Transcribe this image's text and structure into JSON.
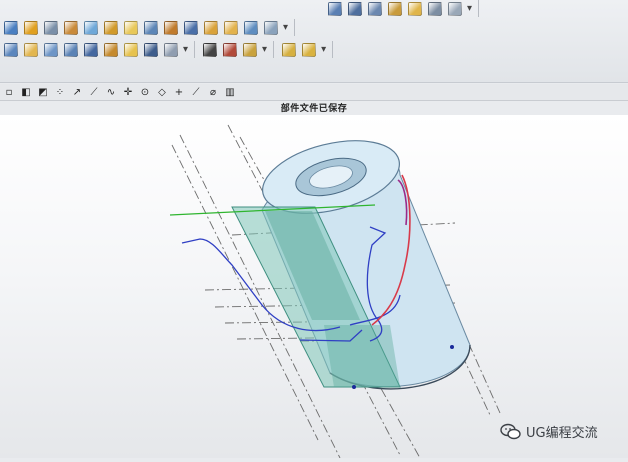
{
  "status": {
    "message": "部件文件已保存"
  },
  "watermark": {
    "text": "UG编程交流",
    "icon": "wechat-icon"
  },
  "toolbar_row1": [
    {
      "icon": "extrude-icon",
      "color": "#4a7fc1"
    },
    {
      "icon": "revolve-icon",
      "color": "#e0a020"
    },
    {
      "icon": "sweep-icon",
      "color": "#7a8fa8"
    },
    {
      "icon": "hole-icon",
      "color": "#c98a3a"
    },
    {
      "icon": "boss-icon",
      "color": "#6fa8d8"
    },
    {
      "icon": "pocket-icon",
      "color": "#d19a2b"
    },
    {
      "icon": "pad-icon",
      "color": "#e8c85a"
    },
    {
      "icon": "slot-icon",
      "color": "#5d86b7"
    },
    {
      "icon": "groove-icon",
      "color": "#c07b2d"
    },
    {
      "icon": "block-icon",
      "color": "#4a6fa8"
    },
    {
      "icon": "cylinder-icon",
      "color": "#d9a23a"
    },
    {
      "icon": "cone-icon",
      "color": "#e2b24c"
    },
    {
      "icon": "sphere-icon",
      "color": "#5e8dc0"
    },
    {
      "icon": "shell-icon",
      "color": "#8aa2bc"
    }
  ],
  "toolbar_row1_right": [
    {
      "icon": "edit-surface-icon",
      "color": "#5a7fb3"
    },
    {
      "icon": "offset-surface-icon",
      "color": "#4f6f9e"
    },
    {
      "icon": "trim-body-icon",
      "color": "#6c88b0"
    },
    {
      "icon": "sew-icon",
      "color": "#c99b3c"
    },
    {
      "icon": "patch-icon",
      "color": "#e0b54a"
    },
    {
      "icon": "measure-icon",
      "color": "#7d8ea3"
    },
    {
      "icon": "analysis-icon",
      "color": "#9aa8b8"
    }
  ],
  "toolbar_row2": [
    {
      "icon": "draft-icon",
      "color": "#5b86bd"
    },
    {
      "icon": "chamfer-icon",
      "color": "#e2b64f"
    },
    {
      "icon": "blend-icon",
      "color": "#6d95c6"
    },
    {
      "icon": "thicken-icon",
      "color": "#5a82b5"
    },
    {
      "icon": "scale-icon",
      "color": "#4468a0"
    },
    {
      "icon": "tube-icon",
      "color": "#c58a2e"
    },
    {
      "icon": "thread-icon",
      "color": "#e6c24e"
    },
    {
      "icon": "split-body-icon",
      "color": "#3e5d8c"
    },
    {
      "icon": "unite-icon",
      "color": "#8f9db0"
    },
    {
      "icon": "triangle-icon",
      "color": "#444444"
    },
    {
      "icon": "datum-plane-icon",
      "color": "#b14a3a"
    },
    {
      "icon": "pattern-icon",
      "color": "#c9a23d"
    },
    {
      "icon": "mirror-icon",
      "color": "#d6b040"
    },
    {
      "icon": "assembly-icon",
      "color": "#d9b23f"
    }
  ],
  "snap_toolbar": [
    {
      "icon": "snap-settings-icon",
      "glyph": "▫"
    },
    {
      "icon": "snap-endpoint-icon",
      "glyph": "◧"
    },
    {
      "icon": "snap-midpoint-icon",
      "glyph": "◩"
    },
    {
      "icon": "snap-control-icon",
      "glyph": "⁘"
    },
    {
      "icon": "snap-line-icon",
      "glyph": "↗"
    },
    {
      "icon": "snap-tangent-icon",
      "glyph": "⟋"
    },
    {
      "icon": "snap-curve-icon",
      "glyph": "∿"
    },
    {
      "icon": "snap-intersection-icon",
      "glyph": "✛"
    },
    {
      "icon": "snap-center-icon",
      "glyph": "⊙"
    },
    {
      "icon": "snap-quadrant-icon",
      "glyph": "◇"
    },
    {
      "icon": "snap-point-icon",
      "glyph": "+"
    },
    {
      "icon": "snap-on-curve-icon",
      "glyph": "⟋"
    },
    {
      "icon": "snap-face-icon",
      "glyph": "⌀"
    },
    {
      "icon": "snap-bar-end-icon",
      "glyph": "▥"
    }
  ],
  "colors": {
    "cylinder_fill": "#cfe4f1",
    "plane_fill": "#7fc6b8",
    "sketch_blue": "#2f3fc4",
    "sketch_red": "#d83a4a",
    "axis_green": "#2fb52f",
    "dash_line": "#6c6c6c"
  }
}
